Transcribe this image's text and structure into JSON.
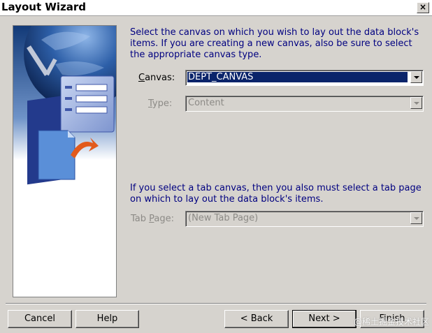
{
  "window": {
    "title": "Layout Wizard",
    "close_label": "×"
  },
  "intro_text": "Select the canvas on which you wish to lay out the data block's items. If you are creating a new canvas, also be sure to select the appropriate canvas type.",
  "canvas": {
    "label_prefix": "",
    "label_mnemonic": "C",
    "label_rest": "anvas:",
    "value": "DEPT_CANVAS"
  },
  "type": {
    "label_mnemonic": "T",
    "label_rest": "ype:",
    "value": "Content"
  },
  "tab_text": "If you select a tab canvas, then you also must select a tab page on which to lay out the data block's items.",
  "tab_page": {
    "label_prefix": "Tab ",
    "label_mnemonic": "P",
    "label_rest": "age:",
    "value": "(New Tab Page)"
  },
  "buttons": {
    "cancel": "Cancel",
    "help": "Help",
    "back": "< Back",
    "next": "Next >",
    "finish": "Finish"
  },
  "watermark": "@稀土掘金技术社区",
  "colors": {
    "instruction_text": "#000080",
    "selection": "#0a246a",
    "dialog_bg": "#d6d3ce"
  }
}
